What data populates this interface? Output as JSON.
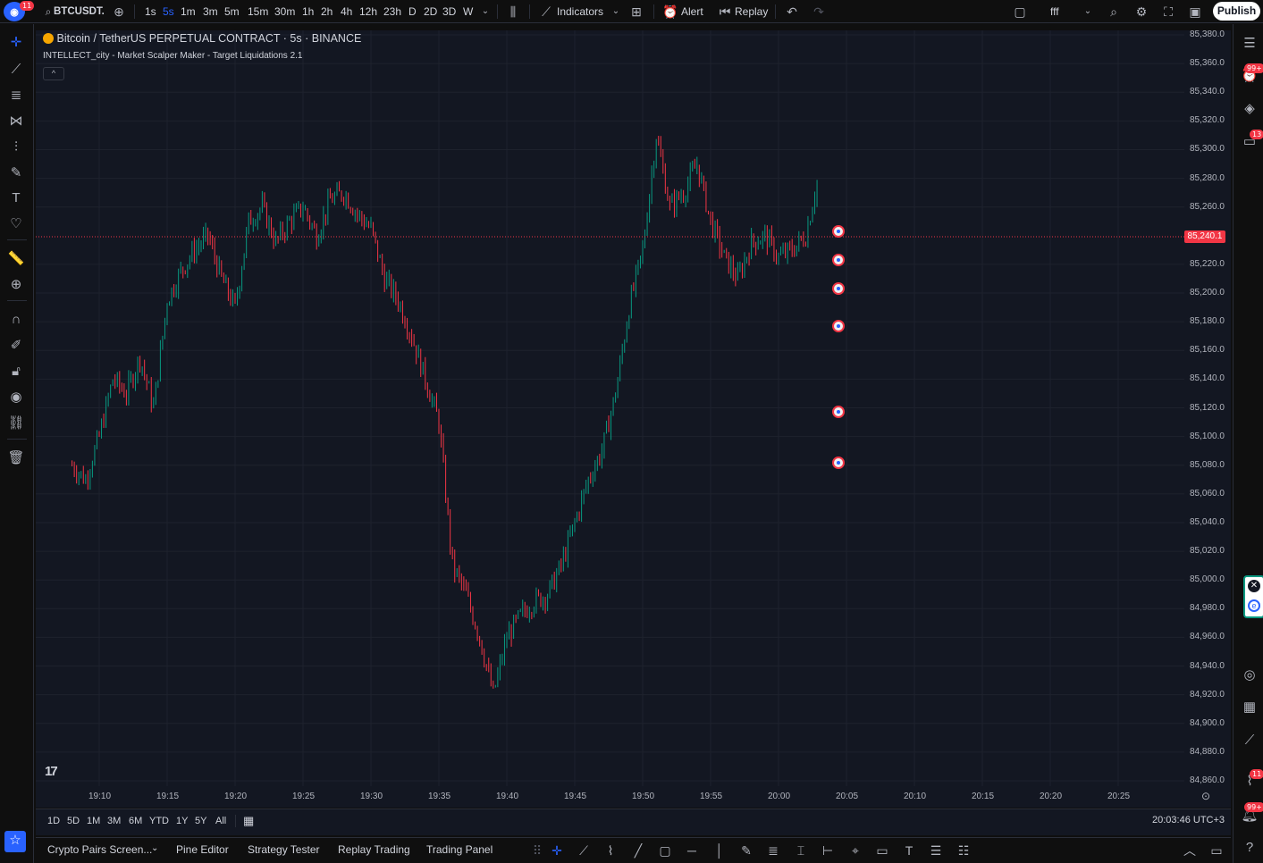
{
  "topbar": {
    "logo_badge": "11",
    "symbol": "BTCUSDT.",
    "intervals": [
      "1s",
      "5s",
      "1m",
      "3m",
      "5m",
      "15m",
      "30m",
      "1h",
      "2h",
      "4h",
      "12h",
      "23h",
      "D",
      "2D",
      "3D",
      "W"
    ],
    "active_interval": "5s",
    "indicators_label": "Indicators",
    "alert_label": "Alert",
    "replay_label": "Replay",
    "layout_name": "fff",
    "publish_label": "Publish"
  },
  "chart": {
    "title": "Bitcoin / TetherUS PERPETUAL CONTRACT · 5s · BINANCE",
    "indicator": "INTELLECT_city - Market Scalper Maker - Target Liquidations 2.1",
    "current_price": "85,240.1",
    "price_ticks": [
      "85,380.0",
      "85,360.0",
      "85,340.0",
      "85,320.0",
      "85,300.0",
      "85,280.0",
      "85,260.0",
      "85,220.0",
      "85,200.0",
      "85,180.0",
      "85,160.0",
      "85,140.0",
      "85,120.0",
      "85,100.0",
      "85,080.0",
      "85,060.0",
      "85,040.0",
      "85,020.0",
      "85,000.0",
      "84,980.0",
      "84,960.0",
      "84,940.0",
      "84,920.0",
      "84,900.0",
      "84,880.0",
      "84,860.0"
    ],
    "time_ticks": [
      "19:10",
      "19:15",
      "19:20",
      "19:25",
      "19:30",
      "19:35",
      "19:40",
      "19:45",
      "19:50",
      "19:55",
      "20:00",
      "20:05",
      "20:10",
      "20:15",
      "20:20",
      "20:25"
    ],
    "colors": {
      "up": "#089981",
      "down": "#f23645",
      "background": "#131722",
      "grid": "#1e222d"
    }
  },
  "chart_data": {
    "type": "line",
    "title": "Bitcoin / TetherUS PERPETUAL CONTRACT · 5s · BINANCE",
    "xlabel": "",
    "ylabel": "",
    "ylim": [
      84860,
      85380
    ],
    "x": [
      "19:08",
      "19:09",
      "19:10",
      "19:11",
      "19:12",
      "19:13",
      "19:14",
      "19:15",
      "19:16",
      "19:17",
      "19:18",
      "19:19",
      "19:20",
      "19:21",
      "19:22",
      "19:23",
      "19:24",
      "19:25",
      "19:26",
      "19:27",
      "19:28",
      "19:29",
      "19:30",
      "19:31",
      "19:32",
      "19:33",
      "19:34",
      "19:35",
      "19:36",
      "19:37",
      "19:38",
      "19:39",
      "19:40",
      "19:41",
      "19:42",
      "19:43",
      "19:44",
      "19:45",
      "19:46",
      "19:47",
      "19:48",
      "19:49",
      "19:50",
      "19:51",
      "19:52",
      "19:53",
      "19:54",
      "19:55",
      "19:56",
      "19:57",
      "19:58",
      "19:59",
      "20:00",
      "20:01",
      "20:02",
      "20:03"
    ],
    "series": [
      {
        "values": [
          85080,
          85070,
          85100,
          85140,
          85130,
          85155,
          85120,
          85195,
          85215,
          85230,
          85240,
          85210,
          85190,
          85250,
          85260,
          85235,
          85250,
          85260,
          85240,
          85265,
          85270,
          85255,
          85245,
          85210,
          85195,
          85170,
          85140,
          85110,
          85010,
          84990,
          84960,
          84920,
          84960,
          84975,
          84985,
          84990,
          85010,
          85040,
          85070,
          85090,
          85130,
          85190,
          85230,
          85310,
          85260,
          85270,
          85290,
          85250,
          85225,
          85210,
          85235,
          85240,
          85225,
          85230,
          85240,
          85285,
          85255,
          85240
        ]
      }
    ]
  },
  "range_bar": {
    "ranges": [
      "1D",
      "5D",
      "1M",
      "3M",
      "6M",
      "YTD",
      "1Y",
      "5Y",
      "All"
    ],
    "clock": "20:03:46 UTC+3"
  },
  "bottombar": {
    "tabs": [
      "Crypto Pairs Screen...",
      "Pine Editor",
      "Strategy Tester",
      "Replay Trading",
      "Trading Panel"
    ]
  },
  "righttb": {
    "badge_alerts": "99+",
    "badge_chats": "13",
    "badge_news": "11",
    "badge_notif": "99+"
  },
  "icons": [
    "search-icon",
    "plus-circle-icon",
    "candles-icon",
    "indicators-icon",
    "templates-icon",
    "alert-icon",
    "replay-icon",
    "undo-icon",
    "redo-icon",
    "fullscreen-icon",
    "camera-icon",
    "settings-icon"
  ]
}
